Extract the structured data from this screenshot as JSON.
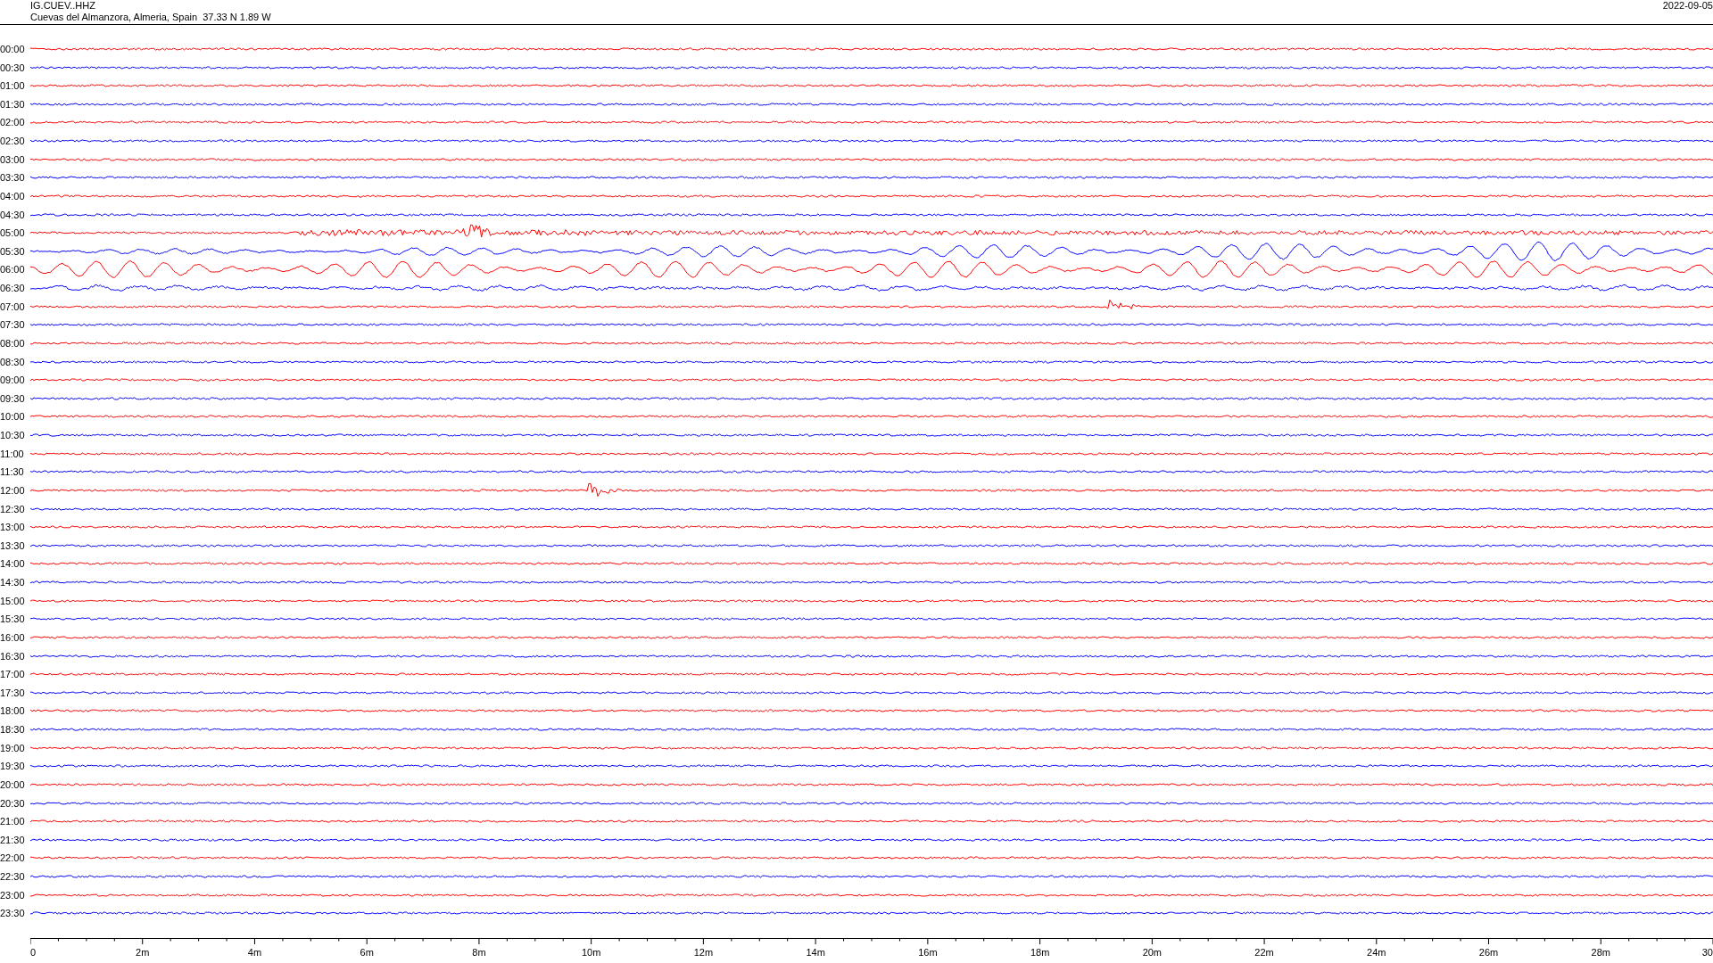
{
  "header": {
    "station": "IG.CUEV..HHZ",
    "location": "Cuevas del Almanzora, Almeria, Spain  37.33 N 1.89 W",
    "date": "2022-09-05"
  },
  "traces": [
    {
      "time": "00:00",
      "color": "#ff0000",
      "kind": "quiet"
    },
    {
      "time": "00:30",
      "color": "#0000ff",
      "kind": "quiet"
    },
    {
      "time": "01:00",
      "color": "#ff0000",
      "kind": "quiet"
    },
    {
      "time": "01:30",
      "color": "#0000ff",
      "kind": "quiet"
    },
    {
      "time": "02:00",
      "color": "#ff0000",
      "kind": "quiet"
    },
    {
      "time": "02:30",
      "color": "#0000ff",
      "kind": "quiet"
    },
    {
      "time": "03:00",
      "color": "#ff0000",
      "kind": "quiet"
    },
    {
      "time": "03:30",
      "color": "#0000ff",
      "kind": "quiet"
    },
    {
      "time": "04:00",
      "color": "#ff0000",
      "kind": "quiet"
    },
    {
      "time": "04:30",
      "color": "#0000ff",
      "kind": "quiet"
    },
    {
      "time": "05:00",
      "color": "#ff0000",
      "kind": "tremor"
    },
    {
      "time": "05:30",
      "color": "#0000ff",
      "kind": "swell"
    },
    {
      "time": "06:00",
      "color": "#ff0000",
      "kind": "swell"
    },
    {
      "time": "06:30",
      "color": "#0000ff",
      "kind": "noisy"
    },
    {
      "time": "07:00",
      "color": "#ff0000",
      "kind": "event"
    },
    {
      "time": "07:30",
      "color": "#0000ff",
      "kind": "quiet"
    },
    {
      "time": "08:00",
      "color": "#ff0000",
      "kind": "quiet"
    },
    {
      "time": "08:30",
      "color": "#0000ff",
      "kind": "quiet"
    },
    {
      "time": "09:00",
      "color": "#ff0000",
      "kind": "quiet"
    },
    {
      "time": "09:30",
      "color": "#0000ff",
      "kind": "quiet"
    },
    {
      "time": "10:00",
      "color": "#ff0000",
      "kind": "quiet"
    },
    {
      "time": "10:30",
      "color": "#0000ff",
      "kind": "quiet"
    },
    {
      "time": "11:00",
      "color": "#ff0000",
      "kind": "quiet"
    },
    {
      "time": "11:30",
      "color": "#0000ff",
      "kind": "quiet"
    },
    {
      "time": "12:00",
      "color": "#ff0000",
      "kind": "event"
    },
    {
      "time": "12:30",
      "color": "#0000ff",
      "kind": "quiet"
    },
    {
      "time": "13:00",
      "color": "#ff0000",
      "kind": "quiet"
    },
    {
      "time": "13:30",
      "color": "#0000ff",
      "kind": "quiet"
    },
    {
      "time": "14:00",
      "color": "#ff0000",
      "kind": "quiet"
    },
    {
      "time": "14:30",
      "color": "#0000ff",
      "kind": "quiet"
    },
    {
      "time": "15:00",
      "color": "#ff0000",
      "kind": "quiet"
    },
    {
      "time": "15:30",
      "color": "#0000ff",
      "kind": "quiet"
    },
    {
      "time": "16:00",
      "color": "#ff0000",
      "kind": "quiet"
    },
    {
      "time": "16:30",
      "color": "#0000ff",
      "kind": "quiet"
    },
    {
      "time": "17:00",
      "color": "#ff0000",
      "kind": "quiet"
    },
    {
      "time": "17:30",
      "color": "#0000ff",
      "kind": "quiet"
    },
    {
      "time": "18:00",
      "color": "#ff0000",
      "kind": "quiet"
    },
    {
      "time": "18:30",
      "color": "#0000ff",
      "kind": "quiet"
    },
    {
      "time": "19:00",
      "color": "#ff0000",
      "kind": "quiet"
    },
    {
      "time": "19:30",
      "color": "#0000ff",
      "kind": "quiet"
    },
    {
      "time": "20:00",
      "color": "#ff0000",
      "kind": "quiet"
    },
    {
      "time": "20:30",
      "color": "#0000ff",
      "kind": "quiet"
    },
    {
      "time": "21:00",
      "color": "#ff0000",
      "kind": "quiet"
    },
    {
      "time": "21:30",
      "color": "#0000ff",
      "kind": "quiet"
    },
    {
      "time": "22:00",
      "color": "#ff0000",
      "kind": "quiet"
    },
    {
      "time": "22:30",
      "color": "#0000ff",
      "kind": "quiet"
    },
    {
      "time": "23:00",
      "color": "#ff0000",
      "kind": "quiet"
    },
    {
      "time": "23:30",
      "color": "#0000ff",
      "kind": "quiet"
    }
  ],
  "x_axis": {
    "ticks": [
      "0",
      "2m",
      "4m",
      "6m",
      "8m",
      "10m",
      "12m",
      "14m",
      "16m",
      "18m",
      "20m",
      "22m",
      "24m",
      "26m",
      "28m",
      "30"
    ]
  }
}
